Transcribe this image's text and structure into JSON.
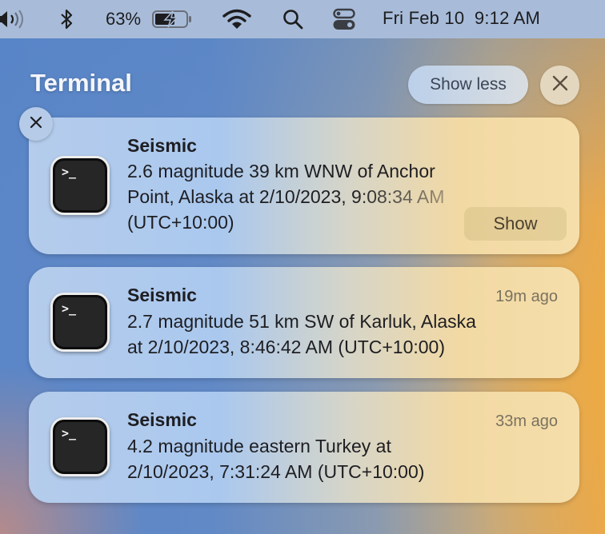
{
  "menubar": {
    "icons": [
      "volume-icon",
      "bluetooth-icon",
      "battery-charging-icon",
      "wifi-icon",
      "spotlight-search-icon",
      "control-center-icon"
    ],
    "battery_percent": "63%",
    "clock": "Fri Feb 10  9:12 AM"
  },
  "notification_center": {
    "group_title": "Terminal",
    "show_less_label": "Show less",
    "clear_group_icon": "close-icon",
    "notifications": [
      {
        "app_icon": "terminal-icon",
        "icon_glyph": ">_",
        "title": "Seismic",
        "body_line1": "2.6 magnitude 39 km WNW of Anchor",
        "body_line2": "Point, Alaska at 2/10/2023, 9:08:34 AM",
        "body_line3": "(UTC+10:00)",
        "action_label": "Show",
        "time": ""
      },
      {
        "app_icon": "terminal-icon",
        "icon_glyph": ">_",
        "title": "Seismic",
        "body_line1": "2.7 magnitude 51 km SW of Karluk, Alaska",
        "body_line2": "at 2/10/2023, 8:46:42 AM (UTC+10:00)",
        "time": "19m ago"
      },
      {
        "app_icon": "terminal-icon",
        "icon_glyph": ">_",
        "title": "Seismic",
        "body_line1": "4.2 magnitude eastern Turkey at",
        "body_line2": "2/10/2023, 7:31:24 AM (UTC+10:00)",
        "time": "33m ago"
      }
    ]
  }
}
